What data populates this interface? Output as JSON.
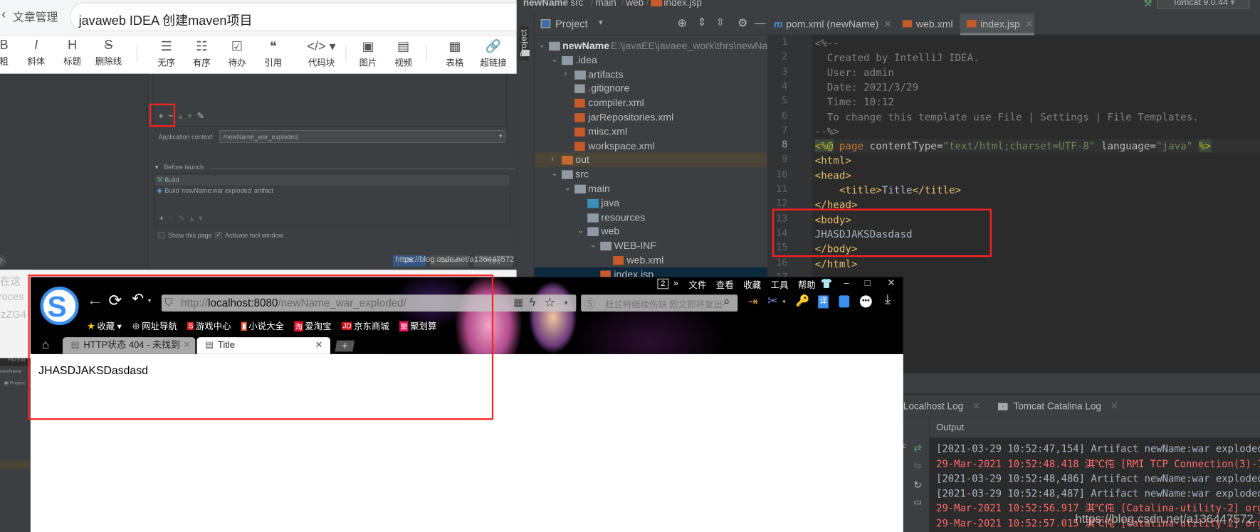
{
  "csdn": {
    "back_label": "文章管理",
    "title_value": "javaweb IDEA 创建maven项目",
    "toolbar": [
      {
        "icon": "bold-icon",
        "glyph": "B",
        "label": "粗"
      },
      {
        "icon": "italic-icon",
        "glyph": "I",
        "label": "斜体"
      },
      {
        "icon": "heading-icon",
        "glyph": "H",
        "label": "标题"
      },
      {
        "icon": "strikethrough-icon",
        "glyph": "S",
        "label": "删除线"
      },
      {
        "icon": "unordered-list-icon",
        "glyph": "☰",
        "label": "无序"
      },
      {
        "icon": "ordered-list-icon",
        "glyph": "☷",
        "label": "有序"
      },
      {
        "icon": "todo-list-icon",
        "glyph": "☑",
        "label": "待办"
      },
      {
        "icon": "quote-icon",
        "glyph": "❝",
        "label": "引用"
      },
      {
        "icon": "code-block-icon",
        "glyph": "</> ▾",
        "label": "代码块"
      },
      {
        "icon": "image-icon",
        "glyph": "▣",
        "label": "图片"
      },
      {
        "icon": "video-icon",
        "glyph": "▤",
        "label": "视频"
      },
      {
        "icon": "table-icon",
        "glyph": "▦",
        "label": "表格"
      },
      {
        "icon": "link-icon",
        "glyph": "🔗",
        "label": "超链接"
      }
    ],
    "behind_text": [
      "在这",
      "roces",
      "lzZG4"
    ]
  },
  "run_config_dialog": {
    "app_context_label": "Application context:",
    "app_context_value": "/newName_war_exploded",
    "before_launch_label": "Before launch",
    "before_launch_items": [
      "Build",
      "Build 'newName:war exploded' artifact"
    ],
    "show_this_page": {
      "label": "Show this page",
      "checked": false
    },
    "activate_tool_window": {
      "label": "Activate tool window",
      "checked": true
    },
    "buttons": {
      "ok": "OK",
      "cancel": "Cancel",
      "apply": "Apply"
    },
    "help": "?"
  },
  "idea": {
    "breadcrumb": [
      "newName",
      "src",
      "main",
      "web",
      "index.jsp"
    ],
    "run_config": "Tomcat 9.0.44",
    "stripe_label": "Project",
    "project_panel_title": "Project",
    "tree": [
      {
        "label": "newName",
        "path": "E:\\javaEE\\javaee_work\\thrs\\newName",
        "depth": 0,
        "chev": "⌄",
        "kind": "module"
      },
      {
        "label": ".idea",
        "depth": 1,
        "chev": "⌄",
        "kind": "folder"
      },
      {
        "label": "artifacts",
        "depth": 2,
        "chev": "›",
        "kind": "folder"
      },
      {
        "label": ".gitignore",
        "depth": 2,
        "chev": "",
        "kind": "file"
      },
      {
        "label": "compiler.xml",
        "depth": 2,
        "chev": "",
        "kind": "xml"
      },
      {
        "label": "jarRepositories.xml",
        "depth": 2,
        "chev": "",
        "kind": "xml"
      },
      {
        "label": "misc.xml",
        "depth": 2,
        "chev": "",
        "kind": "xml"
      },
      {
        "label": "workspace.xml",
        "depth": 2,
        "chev": "",
        "kind": "xml"
      },
      {
        "label": "out",
        "depth": 1,
        "chev": "›",
        "kind": "excluded"
      },
      {
        "label": "src",
        "depth": 1,
        "chev": "⌄",
        "kind": "folder"
      },
      {
        "label": "main",
        "depth": 2,
        "chev": "⌄",
        "kind": "folder"
      },
      {
        "label": "java",
        "depth": 3,
        "chev": "",
        "kind": "source"
      },
      {
        "label": "resources",
        "depth": 3,
        "chev": "",
        "kind": "folder"
      },
      {
        "label": "web",
        "depth": 3,
        "chev": "⌄",
        "kind": "web"
      },
      {
        "label": "WEB-INF",
        "depth": 4,
        "chev": "⌄",
        "kind": "folder"
      },
      {
        "label": "web.xml",
        "depth": 5,
        "chev": "",
        "kind": "xml"
      },
      {
        "label": "index.jsp",
        "depth": 4,
        "chev": "",
        "kind": "jsp",
        "selected": true
      }
    ],
    "tabs": [
      {
        "label": "pom.xml (newName)",
        "icon": "maven-icon",
        "active": false
      },
      {
        "label": "web.xml",
        "icon": "xml-file-icon",
        "active": false
      },
      {
        "label": "index.jsp",
        "icon": "jsp-file-icon",
        "active": true
      }
    ],
    "code_lines": [
      {
        "n": "1",
        "t": [
          [
            "<%--",
            "cm"
          ]
        ]
      },
      {
        "n": "2",
        "t": [
          [
            "  Created by IntelliJ IDEA.",
            "cm"
          ]
        ]
      },
      {
        "n": "3",
        "t": [
          [
            "  User: admin",
            "cm"
          ]
        ]
      },
      {
        "n": "4",
        "t": [
          [
            "  Date: 2021/3/29",
            "cm"
          ]
        ]
      },
      {
        "n": "5",
        "t": [
          [
            "  Time: 10:12",
            "cm"
          ]
        ]
      },
      {
        "n": "6",
        "t": [
          [
            "  To change this template use File | Settings | File Templates.",
            "cm"
          ]
        ]
      },
      {
        "n": "7",
        "t": [
          [
            "--%>",
            "cm"
          ]
        ]
      },
      {
        "n": "8",
        "t": [
          [
            "<%@",
            "dir"
          ],
          [
            " page",
            "kw"
          ],
          [
            " contentType=",
            "at"
          ],
          [
            "\"text/html;charset=UTF-8\"",
            "st"
          ],
          [
            " language=",
            "at"
          ],
          [
            "\"java\"",
            "st"
          ],
          [
            " ",
            ""
          ],
          [
            "%>",
            "dir"
          ]
        ]
      },
      {
        "n": "9",
        "t": [
          [
            "<html>",
            "tg"
          ]
        ]
      },
      {
        "n": "10",
        "t": [
          [
            "<head>",
            "tg"
          ]
        ]
      },
      {
        "n": "11",
        "t": [
          [
            "    <title>",
            "tg"
          ],
          [
            "Title",
            ""
          ],
          [
            "</title>",
            "tg"
          ]
        ]
      },
      {
        "n": "12",
        "t": [
          [
            "</head>",
            "tg"
          ]
        ]
      },
      {
        "n": "13",
        "t": [
          [
            "<body>",
            "tg"
          ]
        ]
      },
      {
        "n": "14",
        "t": [
          [
            "JHASDJAKSDasdasd",
            ""
          ]
        ]
      },
      {
        "n": "15",
        "t": [
          [
            "</body>",
            "tg"
          ]
        ]
      },
      {
        "n": "16",
        "t": [
          [
            "</html>",
            "tg"
          ]
        ]
      },
      {
        "n": "17",
        "t": []
      }
    ],
    "run_tabs": [
      {
        "label": "Localhost Log"
      },
      {
        "label": "Tomcat Catalina Log"
      }
    ],
    "output_label": "Output",
    "console": [
      {
        "text": "[2021-03-29 10:52:47,154] Artifact newName:war exploded: ",
        "level": "info"
      },
      {
        "text": "29-Mar-2021 10:52:48.418 淇℃伅 [RMI TCP Connection(3)-127",
        "level": "err"
      },
      {
        "text": "[2021-03-29 10:52:48,486] Artifact newName:war exploded: ",
        "level": "info"
      },
      {
        "text": "[2021-03-29 10:52:48,487] Artifact newName:war exploded: ",
        "level": "info"
      },
      {
        "text": "29-Mar-2021 10:52:56.917 淇℃伅 [Catalina-utility-2] org.a",
        "level": "err"
      },
      {
        "text": "29-Mar-2021 10:52:57.015 淇℃伅 [Catalina-utility-2] org.a",
        "level": "err"
      }
    ]
  },
  "browser": {
    "menu": [
      "文件",
      "查看",
      "收藏",
      "工具",
      "帮助"
    ],
    "tab_count": "2",
    "more": "»",
    "url_prefix": "http://",
    "url_host": "localhost:8080",
    "url_path": "/newName_war_exploded/",
    "search_placeholder": "杜兰特继续伤缺 欧文即将复出",
    "bookmarks": [
      {
        "label": "收藏 ▾",
        "icon": "star-icon",
        "glyph": "★",
        "color": "#f5c518"
      },
      {
        "label": "网址导航",
        "icon": "globe-icon",
        "glyph": "⊕",
        "color": "#ccc"
      },
      {
        "label": "游戏中心",
        "icon": "game-icon",
        "glyph": "S",
        "color": "#e02020"
      },
      {
        "label": "小说大全",
        "icon": "novel-icon",
        "glyph": "▮",
        "color": "#f05a3a"
      },
      {
        "label": "爱淘宝",
        "icon": "taobao-icon",
        "glyph": "淘",
        "color": "#e0102a"
      },
      {
        "label": "京东商城",
        "icon": "jd-icon",
        "glyph": "JD",
        "color": "#d0101a"
      },
      {
        "label": "聚划算",
        "icon": "juhuasuan-icon",
        "glyph": "聚",
        "color": "#e0105a"
      }
    ],
    "tabs": [
      {
        "label": "HTTP状态 404 - 未找到",
        "active": false
      },
      {
        "label": "Title",
        "active": true
      }
    ],
    "page_content": "JHASDJAKSDasdasd"
  },
  "watermark": "https://blog.csdn.net/a136447572",
  "colors": {
    "highlight_box": "#ff2020",
    "accent_blue": "#4a90e2",
    "console_error": "#ff6b68"
  }
}
